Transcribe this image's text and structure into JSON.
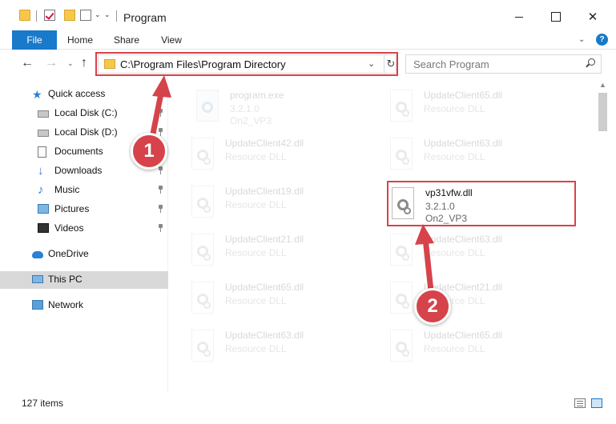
{
  "window": {
    "title": "Program",
    "close_glyph": "✕"
  },
  "ribbon": {
    "tabs": [
      {
        "label": "File"
      },
      {
        "label": "Home"
      },
      {
        "label": "Share"
      },
      {
        "label": "View"
      }
    ],
    "expand_glyph": "⌄",
    "help_glyph": "?"
  },
  "nav": {
    "back_glyph": "←",
    "forward_glyph": "→",
    "recent_glyph": "⌄",
    "up_glyph": "↑",
    "address": "C:\\Program Files\\Program Directory",
    "address_dropdown_glyph": "⌄",
    "refresh_glyph": "↻",
    "search_placeholder": "Search Program"
  },
  "sidebar": {
    "items": [
      {
        "label": "Quick access",
        "icon": "star-icon"
      },
      {
        "label": "Local Disk (C:)",
        "icon": "disk-icon"
      },
      {
        "label": "Local Disk (D:)",
        "icon": "disk-icon"
      },
      {
        "label": "Documents",
        "icon": "documents-icon"
      },
      {
        "label": "Downloads",
        "icon": "downloads-icon"
      },
      {
        "label": "Music",
        "icon": "music-icon"
      },
      {
        "label": "Pictures",
        "icon": "pictures-icon"
      },
      {
        "label": "Videos",
        "icon": "videos-icon"
      },
      {
        "label": "OneDrive",
        "icon": "onedrive-icon"
      },
      {
        "label": "This PC",
        "icon": "this-pc-icon",
        "selected": true
      },
      {
        "label": "Network",
        "icon": "network-icon"
      }
    ],
    "glyphs": {
      "star": "★",
      "download": "↓",
      "music": "♪"
    }
  },
  "files": {
    "left_column": [
      {
        "name": "program.exe",
        "meta1": "3.2.1.0",
        "meta2": "On2_VP3"
      },
      {
        "name": "UpdateClient42.dll",
        "meta1": "Resource DLL"
      },
      {
        "name": "UpdateClient19.dll",
        "meta1": "Resource DLL"
      },
      {
        "name": "UpdateClient21.dll",
        "meta1": "Resource DLL"
      },
      {
        "name": "UpdateClient65.dll",
        "meta1": "Resource DLL"
      },
      {
        "name": "UpdateClient63.dll",
        "meta1": "Resource DLL"
      }
    ],
    "right_column": [
      {
        "name": "UpdateClient65.dll",
        "meta1": "Resource DLL"
      },
      {
        "name": "UpdateClient63.dll",
        "meta1": "Resource DLL"
      },
      {
        "name": "vp31vfw.dll",
        "meta1": "3.2.1.0",
        "meta2": "On2_VP3"
      },
      {
        "name": "UpdateClient63.dll",
        "meta1": "Resource DLL"
      },
      {
        "name": "UpdateClient21.dll",
        "meta1": "Resource DLL"
      },
      {
        "name": "UpdateClient65.dll",
        "meta1": "Resource DLL"
      }
    ]
  },
  "status": {
    "item_count": "127 items"
  },
  "scrollbar": {
    "up_glyph": "▲"
  },
  "callouts": {
    "first": "1",
    "second": "2"
  },
  "colors": {
    "accent": "#1979ca",
    "highlight_red": "#d6434a",
    "folder_yellow": "#f6c84a"
  }
}
